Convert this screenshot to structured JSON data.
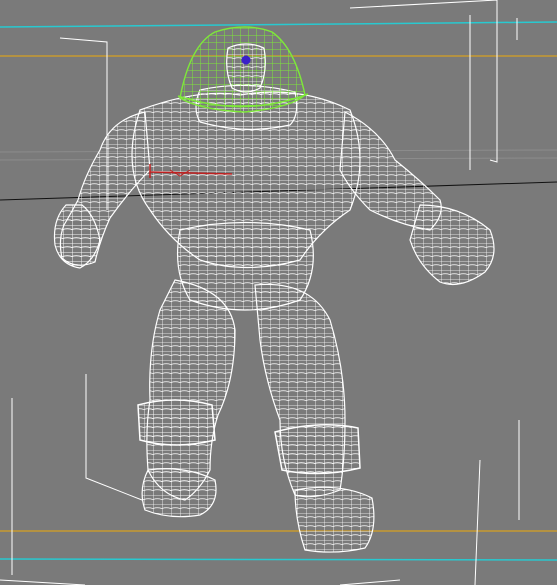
{
  "viewport": {
    "view": "perspective",
    "shading": "wireframe",
    "background_color": "#7a7a7a"
  },
  "colors": {
    "mesh": "#ffffff",
    "selected_mesh": "#7ee83a",
    "guide_cyan": "#28c9d0",
    "guide_orange": "#d6a020",
    "horizon_line": "#111111",
    "bone_marker": "#c02020",
    "eye_marker": "#3a22c8",
    "bounding_box": "#ffffff"
  },
  "scene": {
    "model": "humanoid-character-wireframe",
    "selected_part": "helmet"
  }
}
